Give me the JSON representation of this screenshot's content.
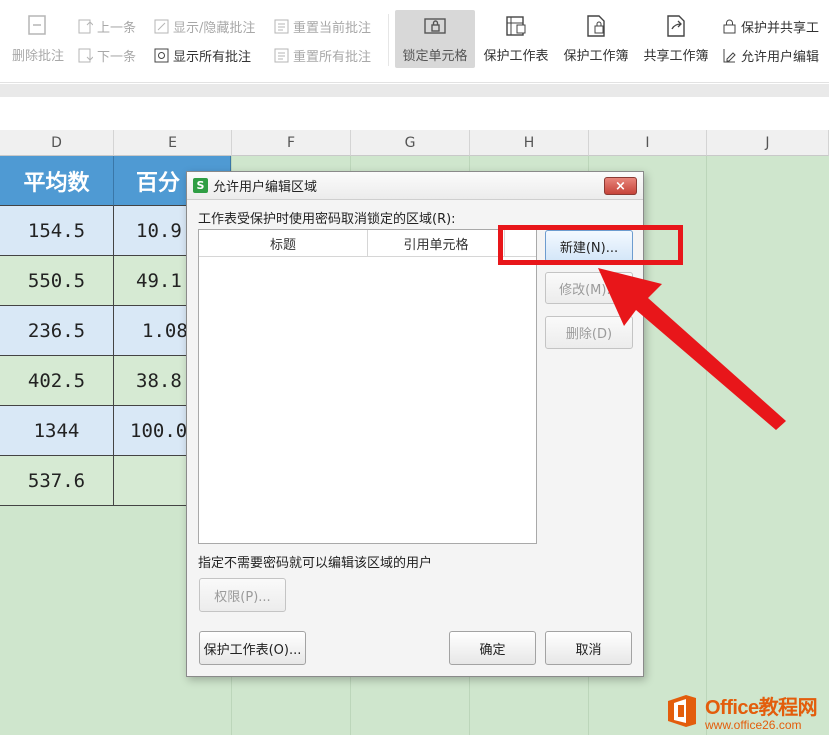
{
  "ribbon": {
    "small_buttons": [
      {
        "id": "prev",
        "label": "上一条"
      },
      {
        "id": "next",
        "label": "下一条"
      },
      {
        "id": "toggle",
        "label": "显示/隐藏批注"
      },
      {
        "id": "show_all",
        "label": "显示所有批注"
      },
      {
        "id": "reset_current",
        "label": "重置当前批注"
      },
      {
        "id": "reset_all",
        "label": "重置所有批注"
      },
      {
        "id": "protect_share",
        "label": "保护并共享工"
      },
      {
        "id": "allow_edit",
        "label": "允许用户编辑"
      }
    ],
    "delete_comment": "删除批注",
    "lock_cell": "锁定单元格",
    "protect_sheet": "保护工作表",
    "protect_book": "保护工作簿",
    "share_book": "共享工作簿"
  },
  "sheet": {
    "columns": [
      "D",
      "E",
      "F",
      "G",
      "H",
      "I",
      "J"
    ],
    "header": {
      "d": "平均数",
      "e": "百分"
    },
    "rows": [
      {
        "d": "154.5",
        "e": "10.9"
      },
      {
        "d": "550.5",
        "e": "49.1"
      },
      {
        "d": "236.5",
        "e": "1.08"
      },
      {
        "d": "402.5",
        "e": "38.8"
      },
      {
        "d": "1344",
        "e": "100.0"
      },
      {
        "d": "537.6",
        "e": ""
      }
    ]
  },
  "dialog": {
    "title": "允许用户编辑区域",
    "close": "×",
    "logo": "S",
    "ranges_label": "工作表受保护时使用密码取消锁定的区域(R):",
    "col_title": "标题",
    "col_ref": "引用单元格",
    "btn_new": "新建(N)...",
    "btn_modify": "修改(M)...",
    "btn_delete": "删除(D)",
    "users_label": "指定不需要密码就可以编辑该区域的用户",
    "btn_permissions": "权限(P)...",
    "btn_protect_sheet": "保护工作表(O)...",
    "btn_ok": "确定",
    "btn_cancel": "取消"
  },
  "watermark": {
    "brand": "Office教程网",
    "url": "www.office26.com"
  },
  "colors": {
    "accent_header": "#4f9ad3",
    "sheet_green": "#cfe6cd",
    "highlight_red": "#e8161a"
  }
}
